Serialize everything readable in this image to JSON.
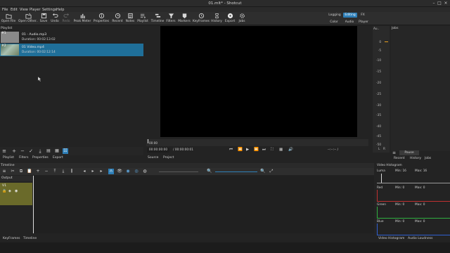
{
  "window": {
    "title": "01.mlt* - Shotcut"
  },
  "menu": [
    "File",
    "Edit",
    "View",
    "Player",
    "Settings",
    "Help"
  ],
  "toolbar": [
    {
      "label": "Open File",
      "icon": "folder-icon"
    },
    {
      "label": "Open Other..",
      "icon": "open-other-icon"
    },
    {
      "label": "Save",
      "icon": "save-icon"
    },
    {
      "label": "Undo",
      "icon": "undo-icon"
    },
    {
      "label": "Redo",
      "icon": "redo-icon"
    },
    {
      "label": "Peak Meter",
      "icon": "peak-meter-icon"
    },
    {
      "label": "Properties",
      "icon": "properties-icon"
    },
    {
      "label": "Recent",
      "icon": "recent-icon"
    },
    {
      "label": "Notes",
      "icon": "notes-icon"
    },
    {
      "label": "Playlist",
      "icon": "playlist-icon"
    },
    {
      "label": "Timeline",
      "icon": "timeline-icon"
    },
    {
      "label": "Filters",
      "icon": "filters-icon"
    },
    {
      "label": "Markers",
      "icon": "markers-icon"
    },
    {
      "label": "KeyFrames",
      "icon": "keyframes-icon"
    },
    {
      "label": "History",
      "icon": "history-icon"
    },
    {
      "label": "Export",
      "icon": "export-icon"
    },
    {
      "label": "Jobs",
      "icon": "jobs-icon"
    }
  ],
  "layouts": {
    "row1": [
      "Logging",
      "Editing",
      "FX"
    ],
    "row2": [
      "Color",
      "Audio",
      "Player"
    ],
    "active": "Editing"
  },
  "playlist": {
    "header": "Playlist",
    "items": [
      {
        "num": "#1",
        "name": "01 - Audio.mp3",
        "duration": "Duration: 00:02:13:02",
        "selected": false
      },
      {
        "num": "#2",
        "name": "01 Video.mp4",
        "duration": "Duration: 00:02:12:14",
        "selected": true
      }
    ],
    "tabs": [
      "Playlist",
      "Filters",
      "Properties",
      "Export"
    ]
  },
  "player": {
    "scrub_time": "00:00",
    "position": "00:00:00:00",
    "total": "/ 00:00:00:01",
    "in_out": "--:--:-- /",
    "tabs": [
      "Source",
      "Project"
    ]
  },
  "audio_meter": {
    "header": "Au..",
    "scale": [
      "0",
      "-5",
      "-10",
      "-15",
      "-20",
      "-25",
      "-30",
      "-35",
      "-40",
      "-45",
      "-50"
    ],
    "footer": [
      "L",
      "R"
    ]
  },
  "jobs": {
    "header": "Jobs",
    "pause": "Pause",
    "tabs": [
      "Recent",
      "History",
      "Jobs"
    ]
  },
  "timeline": {
    "header": "Timeline",
    "output_label": "Output",
    "track_name": "V1"
  },
  "histogram": {
    "header": "Video Histogram",
    "luma": {
      "name": "Luma",
      "min": "Min: 16",
      "max": "Max: 16"
    },
    "red": {
      "name": "Red",
      "min": "Min: 0",
      "max": "Max: 0"
    },
    "green": {
      "name": "Green",
      "min": "Min: 0",
      "max": "Max: 0"
    },
    "blue": {
      "name": "Blue",
      "min": "Min: 0",
      "max": "Max: 0"
    },
    "tabs": [
      "Video Histogram",
      "Audio Loudness"
    ]
  },
  "bottom_tabs": [
    "KeyFrames",
    "Timeline"
  ],
  "colors": {
    "accent": "#2e7fb8",
    "selected_row": "#1f6f99",
    "track": "#6a6a2a"
  }
}
